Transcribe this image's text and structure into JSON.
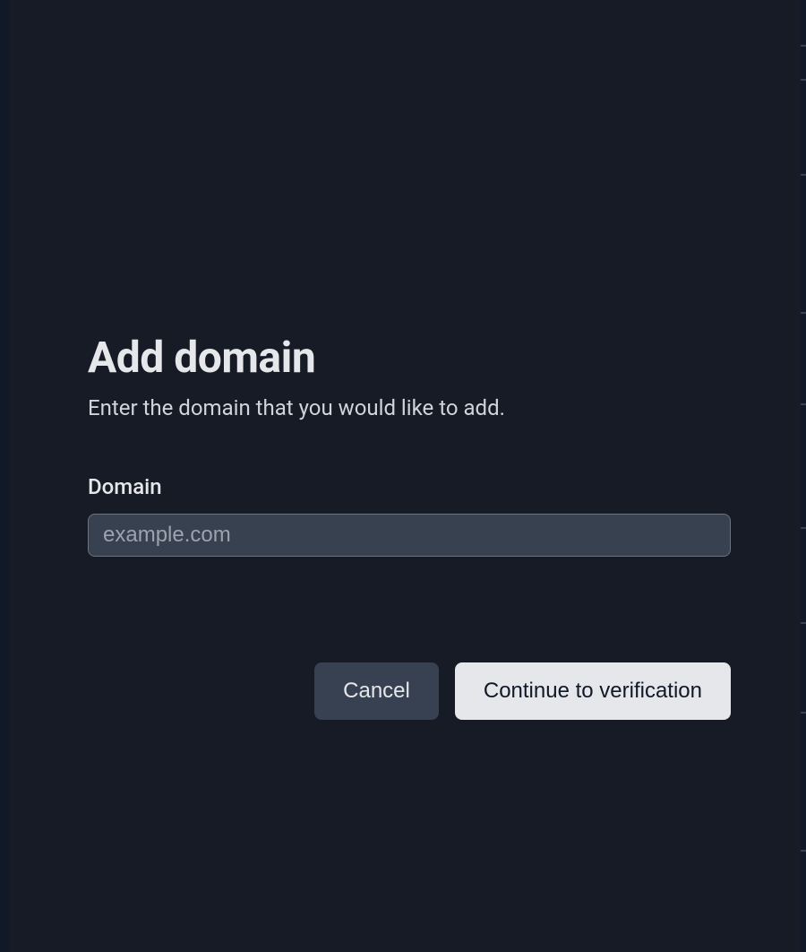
{
  "modal": {
    "title": "Add domain",
    "subtitle": "Enter the domain that you would like to add.",
    "field": {
      "label": "Domain",
      "placeholder": "example.com",
      "value": ""
    },
    "actions": {
      "cancel": "Cancel",
      "continue": "Continue to verification"
    }
  }
}
